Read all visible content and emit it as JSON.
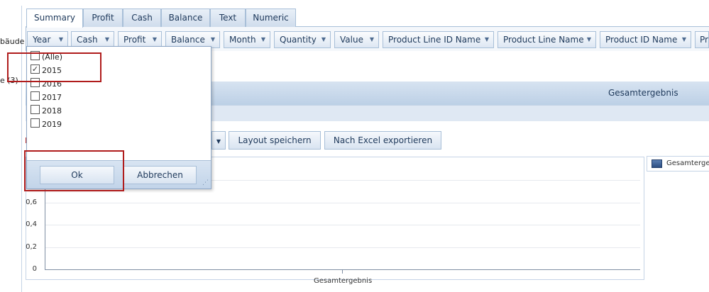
{
  "tabs": [
    "Summary",
    "Profit",
    "Cash",
    "Balance",
    "Text",
    "Numeric"
  ],
  "fields": [
    "Year",
    "Cash",
    "Profit",
    "Balance",
    "Month",
    "Quantity",
    "Value",
    "Product Line ID Name",
    "Product Line Name",
    "Product ID Name",
    "Pr"
  ],
  "left_labels": {
    "row1": "bäude",
    "row2": "e (3)",
    "row3": "I"
  },
  "pivot": {
    "partial_text": "n",
    "grand_total": "Gesamtergebnis"
  },
  "toolbar": {
    "save_layout": "Layout speichern",
    "export_excel": "Nach Excel exportieren"
  },
  "filter_popup": {
    "options": [
      {
        "label": "(Alle)",
        "checked": false
      },
      {
        "label": "2015",
        "checked": true
      },
      {
        "label": "2016",
        "checked": false
      },
      {
        "label": "2017",
        "checked": false
      },
      {
        "label": "2018",
        "checked": false
      },
      {
        "label": "2019",
        "checked": false
      }
    ],
    "ok_label": "Ok",
    "cancel_label": "Abbrechen"
  },
  "chart_data": {
    "type": "bar",
    "categories": [
      "Gesamtergebnis"
    ],
    "series": [
      {
        "name": "Gesamtergebnis",
        "values": []
      }
    ],
    "yticks": [
      "0",
      "0,2",
      "0,4",
      "0,6"
    ],
    "ylim": [
      0,
      1
    ],
    "legend": "right"
  },
  "legend_label": "Gesamtergebnis"
}
